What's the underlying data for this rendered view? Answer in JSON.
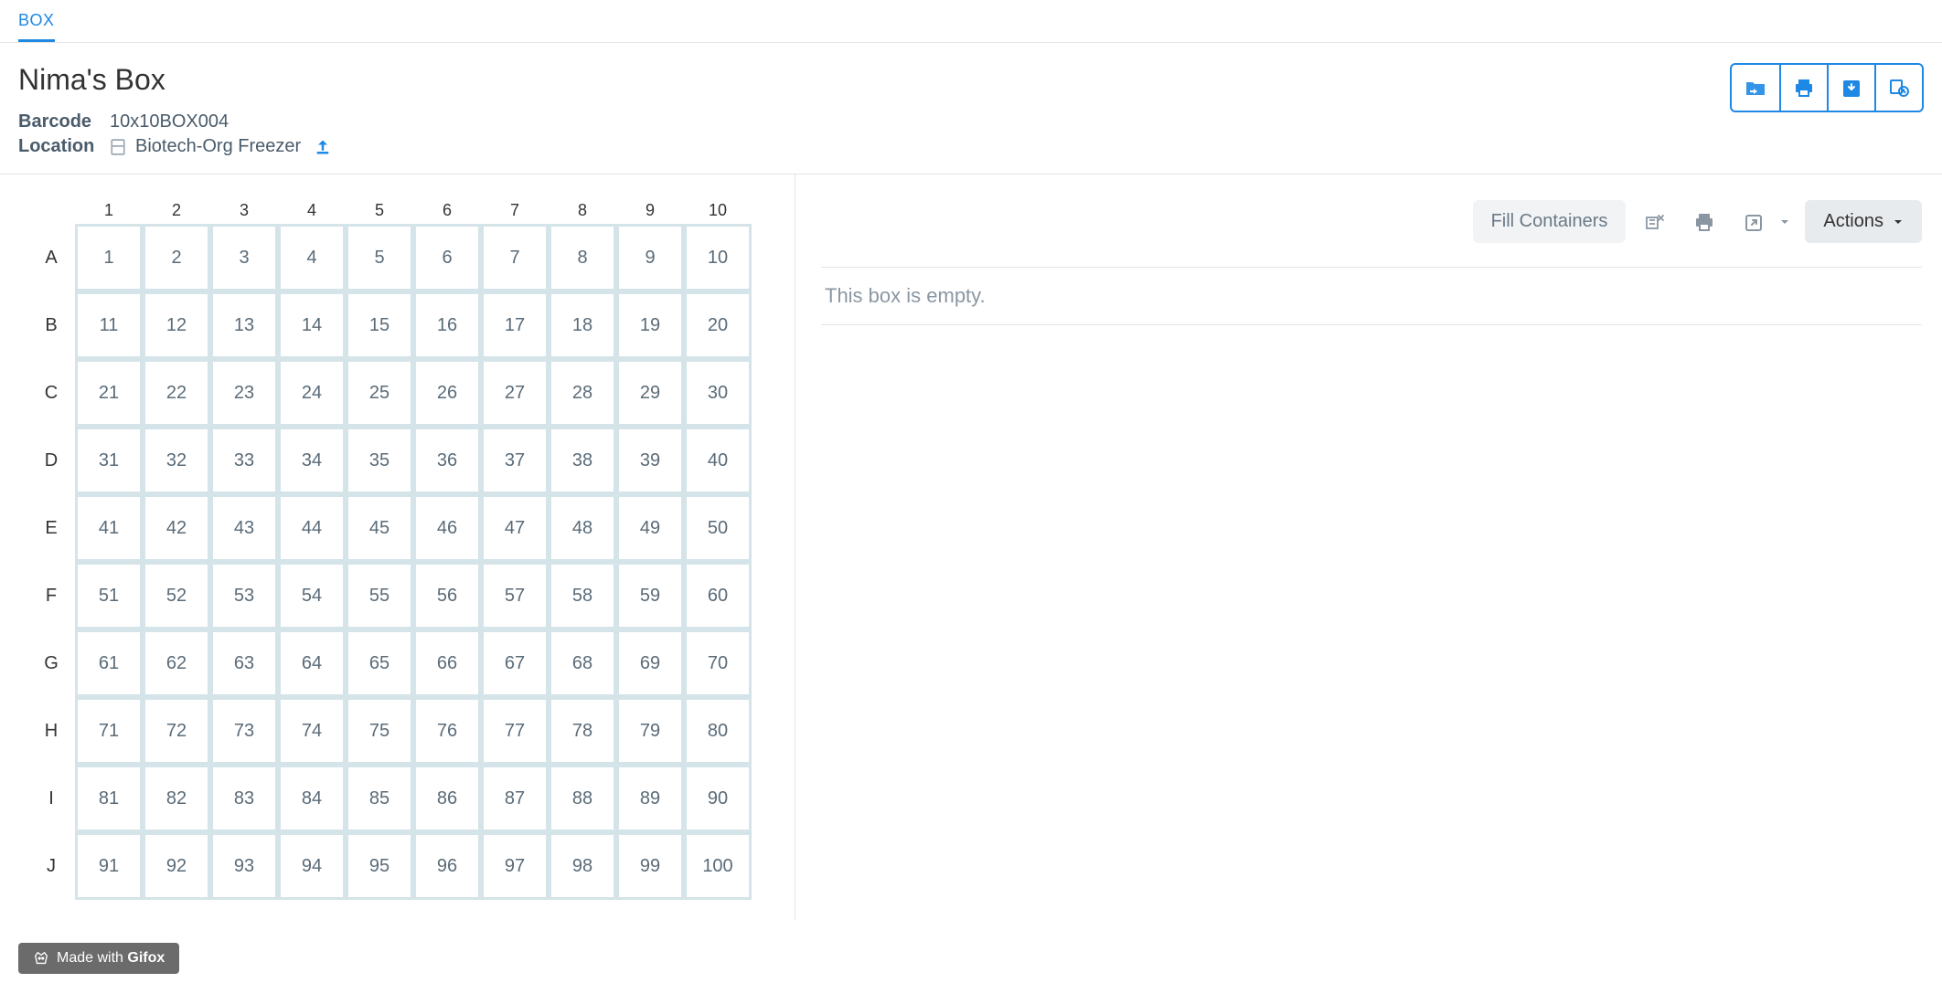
{
  "tab": {
    "label": "BOX"
  },
  "header": {
    "title": "Nima's Box",
    "barcode_label": "Barcode",
    "barcode_value": "10x10BOX004",
    "location_label": "Location",
    "location_value": "Biotech-Org Freezer"
  },
  "grid": {
    "columns": [
      "1",
      "2",
      "3",
      "4",
      "5",
      "6",
      "7",
      "8",
      "9",
      "10"
    ],
    "rows": [
      "A",
      "B",
      "C",
      "D",
      "E",
      "F",
      "G",
      "H",
      "I",
      "J"
    ]
  },
  "right": {
    "fill_label": "Fill Containers",
    "actions_label": "Actions",
    "empty_message": "This box is empty."
  },
  "badge": {
    "prefix": "Made with ",
    "brand": "Gifox"
  }
}
